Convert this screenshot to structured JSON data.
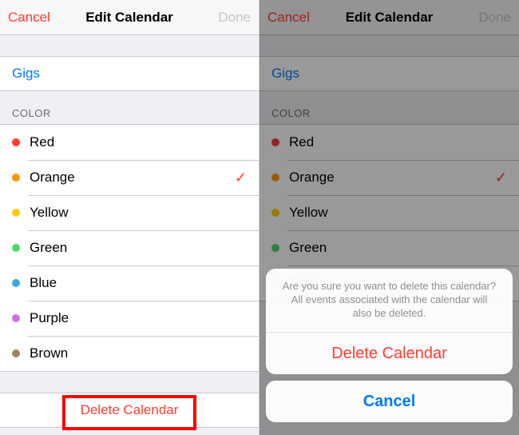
{
  "nav": {
    "cancel": "Cancel",
    "title": "Edit Calendar",
    "done": "Done"
  },
  "calendar_name": "Gigs",
  "section": {
    "color_header": "COLOR"
  },
  "colors": [
    {
      "name": "Red",
      "hex": "#ff3b30",
      "selected": false
    },
    {
      "name": "Orange",
      "hex": "#ff9500",
      "selected": true
    },
    {
      "name": "Yellow",
      "hex": "#ffcc00",
      "selected": false
    },
    {
      "name": "Green",
      "hex": "#4cd964",
      "selected": false
    },
    {
      "name": "Blue",
      "hex": "#34aadc",
      "selected": false
    },
    {
      "name": "Purple",
      "hex": "#cc73e1",
      "selected": false
    },
    {
      "name": "Brown",
      "hex": "#a2845e",
      "selected": false
    }
  ],
  "delete_label": "Delete Calendar",
  "sheet": {
    "message": "Are you sure you want to delete this calendar? All events associated with the calendar will also be deleted.",
    "destructive": "Delete Calendar",
    "cancel": "Cancel"
  }
}
